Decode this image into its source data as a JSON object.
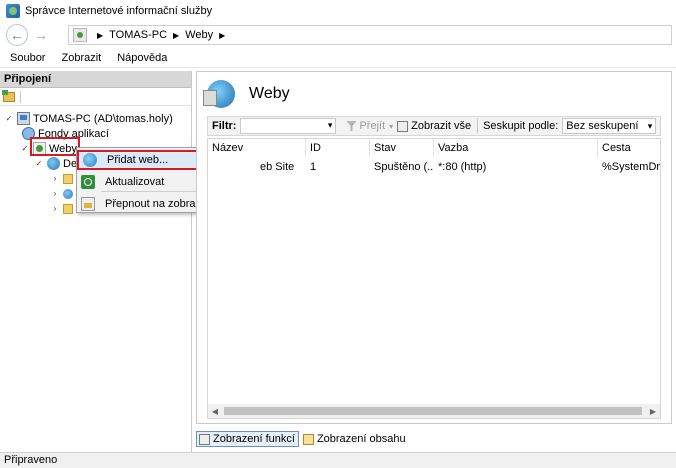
{
  "window": {
    "title": "Správce Internetové informační služby"
  },
  "address": {
    "crumbs": [
      "TOMAS-PC",
      "Weby"
    ]
  },
  "menu": {
    "items": [
      "Soubor",
      "Zobrazit",
      "Nápověda"
    ]
  },
  "connections": {
    "header": "Připojení",
    "tree": {
      "server": "TOMAS-PC (AD\\tomas.holy)",
      "app_pools": "Fondy aplikací",
      "sites": "Weby",
      "default_site_partial": "De"
    }
  },
  "context_menu": {
    "add_site": "Přidat web...",
    "refresh": "Aktualizovat",
    "switch_content": "Přepnout na zobrazení obsahu"
  },
  "main": {
    "title": "Weby",
    "filter": {
      "label": "Filtr:",
      "go": "Přejít",
      "show_all": "Zobrazit vše",
      "group_by_label": "Seskupit podle:",
      "group_by_value": "Bez seskupení"
    },
    "columns": [
      "Název",
      "ID",
      "Stav",
      "Vazba",
      "Cesta"
    ],
    "rows": [
      {
        "name": "eb Site",
        "id": "1",
        "status": "Spuštěno (...",
        "binding": "*:80 (http)",
        "path": "%SystemDrive"
      }
    ]
  },
  "views": {
    "features": "Zobrazení funkcí",
    "content": "Zobrazení obsahu"
  },
  "status": {
    "text": "Připraveno"
  },
  "colors": {
    "highlight": "#d51b24",
    "header_gray": "#d7d7d7"
  }
}
